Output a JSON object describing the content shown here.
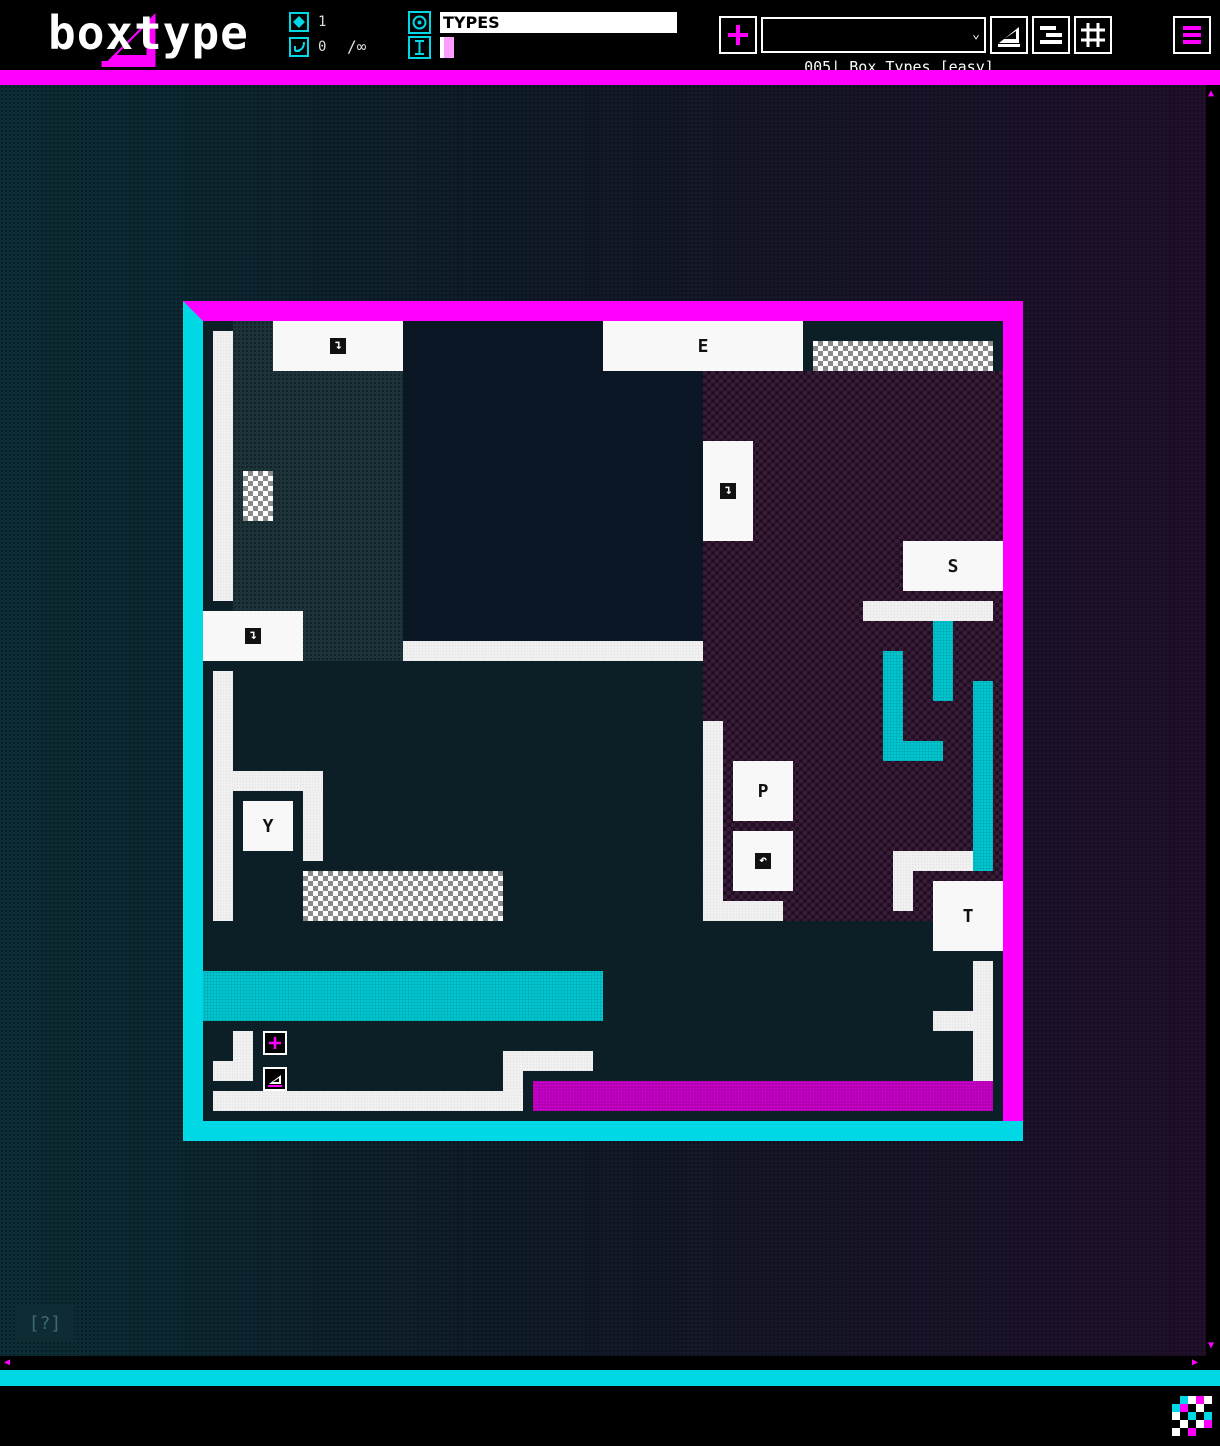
{
  "app": {
    "name": "boxtype"
  },
  "header": {
    "moves_count": "1",
    "undo_count": "0",
    "limit_label": "/∞",
    "level_title": "TYPES",
    "level_select": {
      "selected": "005| Box Types [easy]"
    }
  },
  "help": {
    "label": "[?]"
  },
  "boxes": {
    "e": "E",
    "s": "S",
    "p": "P",
    "y": "Y",
    "t": "T",
    "arrow_glyph": "↴",
    "undo_glyph": "↶"
  },
  "colors": {
    "accent_magenta": "#ff00ff",
    "accent_cyan": "#00d8e6",
    "background": "#000000"
  },
  "icons": {
    "moves": "diamond-icon",
    "undo": "undo-arrow-icon",
    "title": "target-icon",
    "cursor": "text-cursor-icon",
    "add": "plus-icon",
    "edit": "ramp-icon",
    "structure": "steps-icon",
    "grid": "grid-icon",
    "menu": "hamburger-icon"
  }
}
